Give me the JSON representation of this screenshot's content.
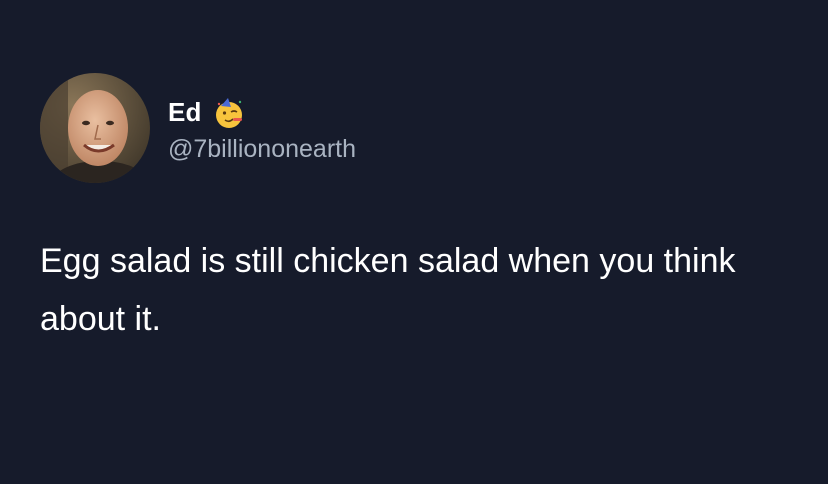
{
  "tweet": {
    "author": {
      "display_name": "Ed",
      "handle": "@7billiononearth",
      "emoji_icon": "partying-face-emoji"
    },
    "text": "Egg salad is still chicken salad when you think about it."
  },
  "colors": {
    "background": "#161b2b",
    "text": "#ffffff",
    "handle": "#a9b3c1"
  }
}
